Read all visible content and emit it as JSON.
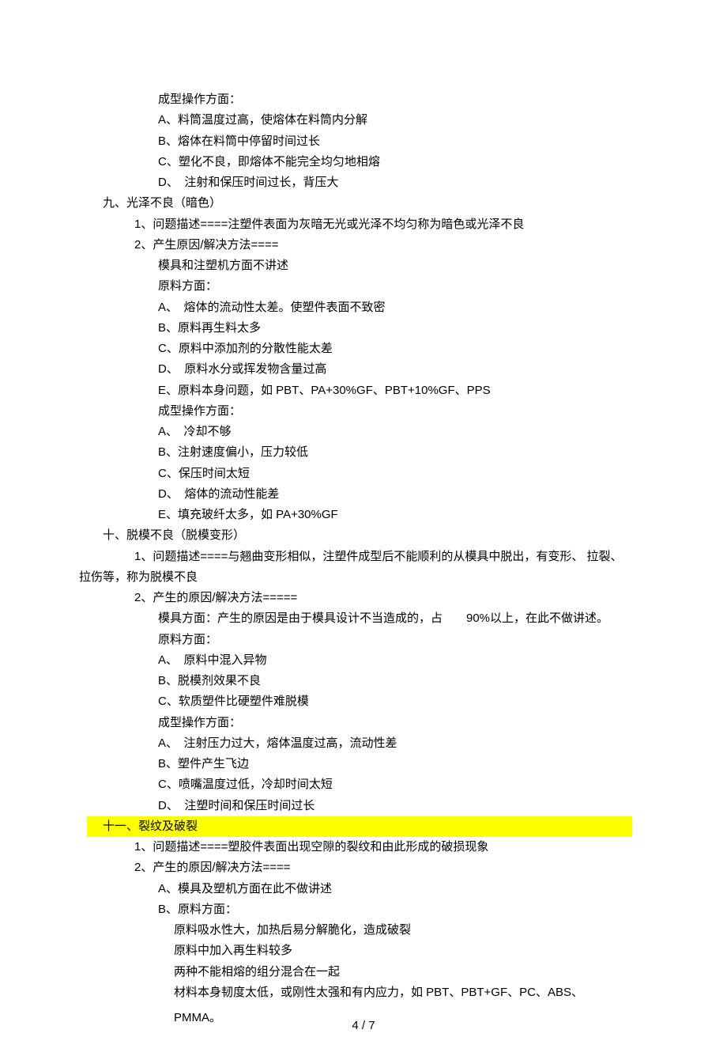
{
  "pre_section": {
    "ops_header": "成型操作方面：",
    "items": [
      "A、料筒温度过高，使熔体在料筒内分解",
      "B、熔体在料筒中停留时间过长",
      "C、塑化不良，即熔体不能完全均匀地相熔",
      "D、　注射和保压时间过长，背压大"
    ]
  },
  "section9": {
    "title": "九、光泽不良（暗色）",
    "desc_label": "1、问题描述====注塑件表面为灰暗无光或光泽不均匀称为暗色或光泽不良",
    "cause_label": "2、产生原因/解决方法====",
    "note1": "模具和注塑机方面不讲述",
    "mat_header": "原料方面：",
    "mat_items": [
      "A、　熔体的流动性太差。使塑件表面不致密",
      "B、原料再生料太多",
      "C、原料中添加剂的分散性能太差",
      "D、　原料水分或挥发物含量过高",
      "E、原料本身问题，如 PBT、PA+30%GF、PBT+10%GF、PPS"
    ],
    "ops_header": "成型操作方面：",
    "ops_items": [
      "A、　冷却不够",
      "B、注射速度偏小，压力较低",
      "C、保压时间太短",
      "D、　熔体的流动性能差",
      "E、填充玻纤太多，如 PA+30%GF"
    ]
  },
  "section10": {
    "title": "十、脱模不良（脱模变形）",
    "desc_label": "1、问题描述====与翘曲变形相似，注塑件成型后不能顺利的从模具中脱出，有变形、 拉裂、",
    "desc_cont": "拉伤等，称为脱模不良",
    "cause_label": "2、产生的原因/解决方法=====",
    "mold_note": "模具方面：产生的原因是由于模具设计不当造成的，占　　90%以上，在此不做讲述。",
    "mat_header": "原料方面：",
    "mat_items": [
      "A、　原料中混入异物",
      "B、脱模剂效果不良",
      "C、软质塑件比硬塑件难脱模"
    ],
    "ops_header": "成型操作方面：",
    "ops_items": [
      "A、　注射压力过大，熔体温度过高，流动性差",
      "B、塑件产生飞边",
      "C、喷嘴温度过低，冷却时间太短",
      "D、　注塑时间和保压时间过长"
    ]
  },
  "section11": {
    "title": "十一、裂纹及破裂",
    "desc_label": "1、问题描述====塑胶件表面出现空隙的裂纹和由此形成的破损现象",
    "cause_label": "2、产生的原因/解决方法====",
    "item_a": "A、模具及塑机方面在此不做讲述",
    "item_b_header": "B、原料方面：",
    "b_items": [
      "原料吸水性大，加热后易分解脆化，造成破裂",
      "原料中加入再生料较多",
      "两种不能相熔的组分混合在一起",
      "材料本身韧度太低，或刚性太强和有内应力，如 PBT、PBT+GF、PC、ABS、"
    ],
    "b_tail": "PMMA。"
  },
  "footer": "4 / 7"
}
